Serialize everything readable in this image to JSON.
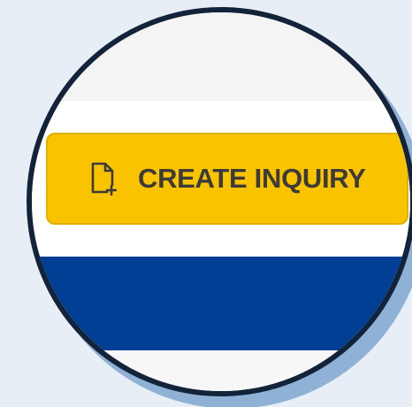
{
  "actions": {
    "create_inquiry": {
      "label": "CREATE INQUIRY",
      "icon": "file-plus-icon"
    }
  },
  "colors": {
    "button_background": "#fac300",
    "button_text": "#3b3b3b",
    "blue_band": "#003f94",
    "ring_border": "#13233a",
    "page_background": "#e8eef6"
  }
}
